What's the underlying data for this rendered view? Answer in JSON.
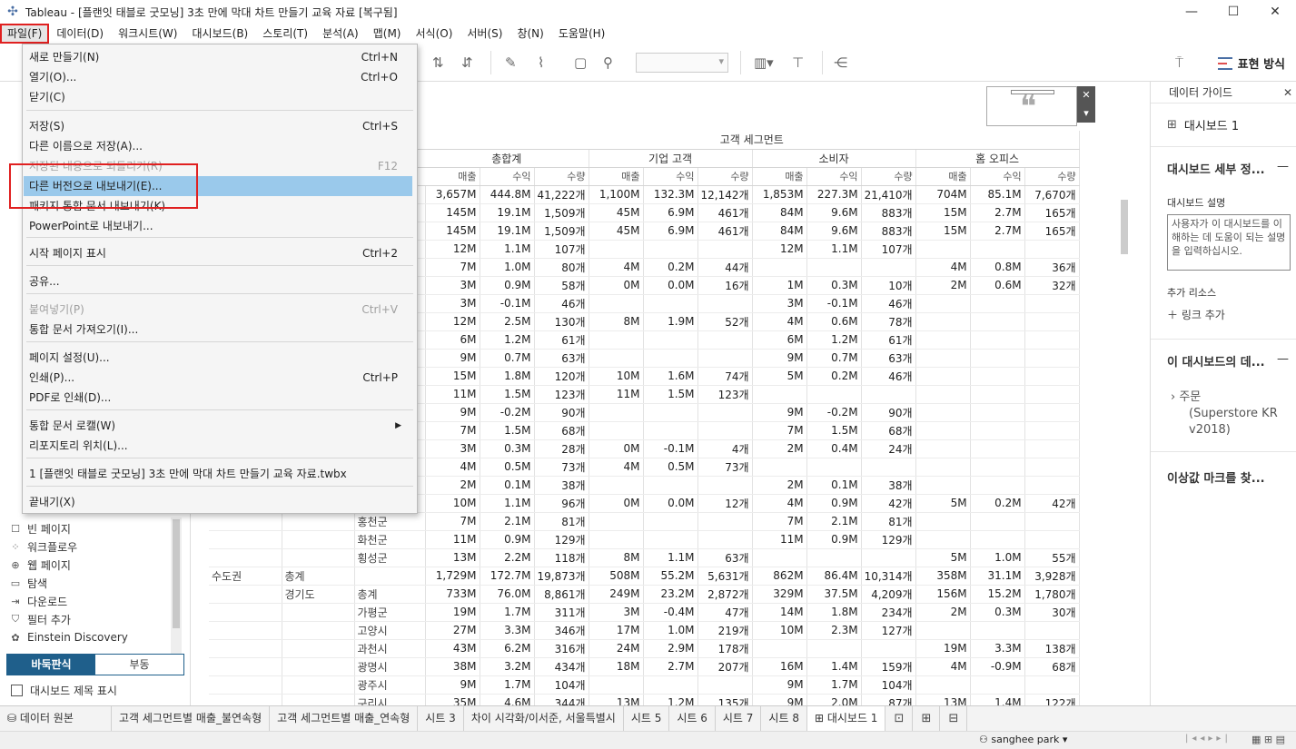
{
  "window": {
    "title": "Tableau - [플랜잇 태블로 굿모닝] 3초 만에 막대 차트 만들기 교육 자료 [복구됨]",
    "minimize": "—",
    "maximize": "☐",
    "close": "✕"
  },
  "menubar": [
    {
      "label": "파일(F)",
      "active": true
    },
    {
      "label": "데이터(D)"
    },
    {
      "label": "워크시트(W)"
    },
    {
      "label": "대시보드(B)"
    },
    {
      "label": "스토리(T)"
    },
    {
      "label": "분석(A)"
    },
    {
      "label": "맵(M)"
    },
    {
      "label": "서식(O)"
    },
    {
      "label": "서버(S)"
    },
    {
      "label": "창(N)"
    },
    {
      "label": "도움말(H)"
    }
  ],
  "toolbar": {
    "show_me": "표현 방식"
  },
  "file_menu": {
    "items": [
      {
        "label": "새로 만들기(N)",
        "shortcut": "Ctrl+N"
      },
      {
        "label": "열기(O)...",
        "shortcut": "Ctrl+O"
      },
      {
        "label": "닫기(C)",
        "shortcut": ""
      },
      {
        "label": "저장(S)",
        "shortcut": "Ctrl+S"
      },
      {
        "label": "다른 이름으로 저장(A)...",
        "shortcut": ""
      },
      {
        "label": "저장된 내용으로 되돌리기(R)",
        "shortcut": "F12",
        "disabled": true
      },
      {
        "label": "다른 버전으로 내보내기(E)...",
        "shortcut": "",
        "highlighted": true
      },
      {
        "label": "패키지 통합 문서 내보내기(K)",
        "shortcut": ""
      },
      {
        "label": "PowerPoint로 내보내기...",
        "shortcut": ""
      },
      {
        "label": "시작 페이지 표시",
        "shortcut": "Ctrl+2"
      },
      {
        "label": "공유...",
        "shortcut": ""
      },
      {
        "label": "붙여넣기(P)",
        "shortcut": "Ctrl+V",
        "disabled": true
      },
      {
        "label": "통합 문서 가져오기(I)...",
        "shortcut": ""
      },
      {
        "label": "페이지 설정(U)...",
        "shortcut": ""
      },
      {
        "label": "인쇄(P)...",
        "shortcut": "Ctrl+P"
      },
      {
        "label": "PDF로 인쇄(D)...",
        "shortcut": ""
      },
      {
        "label": "통합 문서 로캘(W)",
        "shortcut": "",
        "submenu": true
      },
      {
        "label": "리포지토리 위치(L)...",
        "shortcut": ""
      },
      {
        "label": "1 [플랜잇 태블로 굿모닝] 3초 만에 막대 차트 만들기 교육 자료.twbx",
        "shortcut": ""
      },
      {
        "label": "끝내기(X)",
        "shortcut": ""
      }
    ]
  },
  "left_pane": {
    "objects": [
      {
        "label": "빈 페이지",
        "icon": "blank-page-icon",
        "glyph": "☐"
      },
      {
        "label": "워크플로우",
        "icon": "workflow-icon",
        "glyph": "⁘"
      },
      {
        "label": "웹 페이지",
        "icon": "globe-icon",
        "glyph": "⊕"
      },
      {
        "label": "탐색",
        "icon": "navigation-icon",
        "glyph": "▭"
      },
      {
        "label": "다운로드",
        "icon": "download-icon",
        "glyph": "⇥"
      },
      {
        "label": "필터 추가",
        "icon": "filter-add-icon",
        "glyph": "⛉"
      },
      {
        "label": "Einstein Discovery",
        "icon": "einstein-icon",
        "glyph": "✿"
      }
    ],
    "tiled": "바둑판식",
    "floating": "부동",
    "show_title": "대시보드 제목 표시"
  },
  "crosstab": {
    "top_header": "고객 세그먼트",
    "segments": [
      "총합계",
      "기업 고객",
      "소비자",
      "홈 오피스"
    ],
    "measures": [
      "매출",
      "수익",
      "수량"
    ],
    "rows": [
      {
        "c1": "",
        "c2": "",
        "c3": "",
        "v": [
          "3,657M",
          "444.8M",
          "41,222개",
          "1,100M",
          "132.3M",
          "12,142개",
          "1,853M",
          "227.3M",
          "21,410개",
          "704M",
          "85.1M",
          "7,670개"
        ]
      },
      {
        "c1": "",
        "c2": "",
        "c3": "",
        "v": [
          "145M",
          "19.1M",
          "1,509개",
          "45M",
          "6.9M",
          "461개",
          "84M",
          "9.6M",
          "883개",
          "15M",
          "2.7M",
          "165개"
        ]
      },
      {
        "c1": "",
        "c2": "",
        "c3": "",
        "v": [
          "145M",
          "19.1M",
          "1,509개",
          "45M",
          "6.9M",
          "461개",
          "84M",
          "9.6M",
          "883개",
          "15M",
          "2.7M",
          "165개"
        ]
      },
      {
        "c1": "",
        "c2": "",
        "c3": "",
        "v": [
          "12M",
          "1.1M",
          "107개",
          "",
          "",
          "",
          "12M",
          "1.1M",
          "107개",
          "",
          "",
          ""
        ]
      },
      {
        "c1": "",
        "c2": "",
        "c3": "",
        "v": [
          "7M",
          "1.0M",
          "80개",
          "4M",
          "0.2M",
          "44개",
          "",
          "",
          "",
          "4M",
          "0.8M",
          "36개"
        ]
      },
      {
        "c1": "",
        "c2": "",
        "c3": "",
        "v": [
          "3M",
          "0.9M",
          "58개",
          "0M",
          "0.0M",
          "16개",
          "1M",
          "0.3M",
          "10개",
          "2M",
          "0.6M",
          "32개"
        ]
      },
      {
        "c1": "",
        "c2": "",
        "c3": "",
        "v": [
          "3M",
          "-0.1M",
          "46개",
          "",
          "",
          "",
          "3M",
          "-0.1M",
          "46개",
          "",
          "",
          ""
        ]
      },
      {
        "c1": "",
        "c2": "",
        "c3": "",
        "v": [
          "12M",
          "2.5M",
          "130개",
          "8M",
          "1.9M",
          "52개",
          "4M",
          "0.6M",
          "78개",
          "",
          "",
          ""
        ]
      },
      {
        "c1": "",
        "c2": "",
        "c3": "",
        "v": [
          "6M",
          "1.2M",
          "61개",
          "",
          "",
          "",
          "6M",
          "1.2M",
          "61개",
          "",
          "",
          ""
        ]
      },
      {
        "c1": "",
        "c2": "",
        "c3": "",
        "v": [
          "9M",
          "0.7M",
          "63개",
          "",
          "",
          "",
          "9M",
          "0.7M",
          "63개",
          "",
          "",
          ""
        ]
      },
      {
        "c1": "",
        "c2": "",
        "c3": "",
        "v": [
          "15M",
          "1.8M",
          "120개",
          "10M",
          "1.6M",
          "74개",
          "5M",
          "0.2M",
          "46개",
          "",
          "",
          ""
        ]
      },
      {
        "c1": "",
        "c2": "",
        "c3": "",
        "v": [
          "11M",
          "1.5M",
          "123개",
          "11M",
          "1.5M",
          "123개",
          "",
          "",
          "",
          "",
          "",
          ""
        ]
      },
      {
        "c1": "",
        "c2": "",
        "c3": "",
        "v": [
          "9M",
          "-0.2M",
          "90개",
          "",
          "",
          "",
          "9M",
          "-0.2M",
          "90개",
          "",
          "",
          ""
        ]
      },
      {
        "c1": "",
        "c2": "",
        "c3": "",
        "v": [
          "7M",
          "1.5M",
          "68개",
          "",
          "",
          "",
          "7M",
          "1.5M",
          "68개",
          "",
          "",
          ""
        ]
      },
      {
        "c1": "",
        "c2": "",
        "c3": "",
        "v": [
          "3M",
          "0.3M",
          "28개",
          "0M",
          "-0.1M",
          "4개",
          "2M",
          "0.4M",
          "24개",
          "",
          "",
          ""
        ]
      },
      {
        "c1": "",
        "c2": "",
        "c3": "",
        "v": [
          "4M",
          "0.5M",
          "73개",
          "4M",
          "0.5M",
          "73개",
          "",
          "",
          "",
          "",
          "",
          ""
        ]
      },
      {
        "c1": "",
        "c2": "",
        "c3": "",
        "v": [
          "2M",
          "0.1M",
          "38개",
          "",
          "",
          "",
          "2M",
          "0.1M",
          "38개",
          "",
          "",
          ""
        ]
      },
      {
        "c1": "",
        "c2": "",
        "c3": "",
        "v": [
          "10M",
          "1.1M",
          "96개",
          "0M",
          "0.0M",
          "12개",
          "4M",
          "0.9M",
          "42개",
          "5M",
          "0.2M",
          "42개"
        ]
      },
      {
        "c1": "",
        "c2": "",
        "c3": "홍천군",
        "v": [
          "7M",
          "2.1M",
          "81개",
          "",
          "",
          "",
          "7M",
          "2.1M",
          "81개",
          "",
          "",
          ""
        ]
      },
      {
        "c1": "",
        "c2": "",
        "c3": "화천군",
        "v": [
          "11M",
          "0.9M",
          "129개",
          "",
          "",
          "",
          "11M",
          "0.9M",
          "129개",
          "",
          "",
          ""
        ]
      },
      {
        "c1": "",
        "c2": "",
        "c3": "횡성군",
        "v": [
          "13M",
          "2.2M",
          "118개",
          "8M",
          "1.1M",
          "63개",
          "",
          "",
          "",
          "5M",
          "1.0M",
          "55개"
        ]
      },
      {
        "c1": "수도권",
        "c2": "총계",
        "c3": "",
        "v": [
          "1,729M",
          "172.7M",
          "19,873개",
          "508M",
          "55.2M",
          "5,631개",
          "862M",
          "86.4M",
          "10,314개",
          "358M",
          "31.1M",
          "3,928개"
        ]
      },
      {
        "c1": "",
        "c2": "경기도",
        "c3": "총계",
        "v": [
          "733M",
          "76.0M",
          "8,861개",
          "249M",
          "23.2M",
          "2,872개",
          "329M",
          "37.5M",
          "4,209개",
          "156M",
          "15.2M",
          "1,780개"
        ]
      },
      {
        "c1": "",
        "c2": "",
        "c3": "가평군",
        "v": [
          "19M",
          "1.7M",
          "311개",
          "3M",
          "-0.4M",
          "47개",
          "14M",
          "1.8M",
          "234개",
          "2M",
          "0.3M",
          "30개"
        ]
      },
      {
        "c1": "",
        "c2": "",
        "c3": "고양시",
        "v": [
          "27M",
          "3.3M",
          "346개",
          "17M",
          "1.0M",
          "219개",
          "10M",
          "2.3M",
          "127개",
          "",
          "",
          ""
        ]
      },
      {
        "c1": "",
        "c2": "",
        "c3": "과천시",
        "v": [
          "43M",
          "6.2M",
          "316개",
          "24M",
          "2.9M",
          "178개",
          "",
          "",
          "",
          "19M",
          "3.3M",
          "138개"
        ]
      },
      {
        "c1": "",
        "c2": "",
        "c3": "광명시",
        "v": [
          "38M",
          "3.2M",
          "434개",
          "18M",
          "2.7M",
          "207개",
          "16M",
          "1.4M",
          "159개",
          "4M",
          "-0.9M",
          "68개"
        ]
      },
      {
        "c1": "",
        "c2": "",
        "c3": "광주시",
        "v": [
          "9M",
          "1.7M",
          "104개",
          "",
          "",
          "",
          "9M",
          "1.7M",
          "104개",
          "",
          "",
          ""
        ]
      },
      {
        "c1": "",
        "c2": "",
        "c3": "구리시",
        "v": [
          "35M",
          "4.6M",
          "344개",
          "13M",
          "1.2M",
          "135개",
          "9M",
          "2.0M",
          "87개",
          "13M",
          "1.4M",
          "122개"
        ]
      }
    ]
  },
  "right_pane": {
    "header": "데이터 가이드",
    "dashboard_name": "대시보드 1",
    "detail_section": "대시보드 세부 정...",
    "description_label": "대시보드 설명",
    "description_placeholder": "사용자가 이 대시보드를 이해하는 데 도움이 되는 설명을 입력하십시오.",
    "resources_label": "추가 리소스",
    "add_link": "링크 추가",
    "data_section": "이 대시보드의 데...",
    "data_source": "주문",
    "data_source_detail": "(Superstore KR v2018)",
    "outliers": "이상값 마크를 찾..."
  },
  "tabs": [
    {
      "label": "데이터 원본",
      "icon": "datasource-icon"
    },
    {
      "label": "고객 세그먼트별 매출_불연속형"
    },
    {
      "label": "고객 세그먼트별 매출_연속형"
    },
    {
      "label": "시트 3"
    },
    {
      "label": "차이 시각화/이서준, 서울특별시"
    },
    {
      "label": "시트 5"
    },
    {
      "label": "시트 6"
    },
    {
      "label": "시트 7"
    },
    {
      "label": "시트 8"
    },
    {
      "label": "대시보드 1",
      "active": true
    }
  ],
  "status": {
    "user": "sanghee park"
  }
}
